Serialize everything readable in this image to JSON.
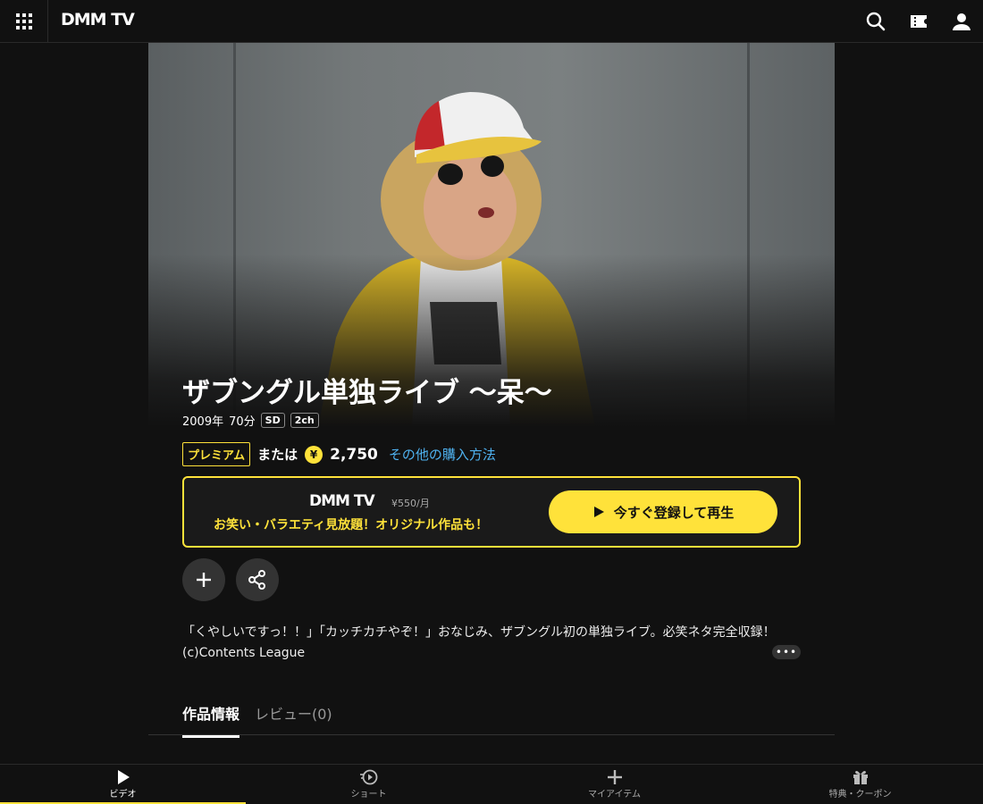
{
  "header": {
    "logo": "DMM TV",
    "icons": [
      "grid-menu-icon",
      "search-icon",
      "ticket-icon",
      "user-icon"
    ]
  },
  "title": {
    "main": "ザブングル単独ライブ 〜呆〜"
  },
  "meta": {
    "year": "2009年",
    "duration": "70分",
    "quality": "SD",
    "audio": "2ch"
  },
  "pricing": {
    "premium": "プレミアム",
    "or": "または",
    "yen_symbol": "¥",
    "price": "2,750",
    "other_link": "その他の購入方法"
  },
  "promo": {
    "logo": "DMM TV",
    "fee": "¥550/月",
    "text": "お笑い・バラエティ見放題！オリジナル作品も！",
    "cta": "今すぐ登録して再生"
  },
  "description": {
    "line1": "「くやしいですっ！！」「カッチカチやぞ！」おなじみ、ザブングル初の単独ライブ。必笑ネタ完全収録！",
    "line2": "(c)Contents League",
    "more": "•••"
  },
  "tabs": [
    {
      "label": "作品情報"
    },
    {
      "label": "レビュー(0)"
    }
  ],
  "bottom_nav": [
    {
      "label": "ビデオ",
      "icon": "play-icon"
    },
    {
      "label": "ショート",
      "icon": "short-icon"
    },
    {
      "label": "マイアイテム",
      "icon": "plus-icon"
    },
    {
      "label": "特典・クーポン",
      "icon": "gift-icon"
    }
  ],
  "colors": {
    "accent": "#ffe23a",
    "link": "#4fb2f0",
    "background": "#111111"
  }
}
